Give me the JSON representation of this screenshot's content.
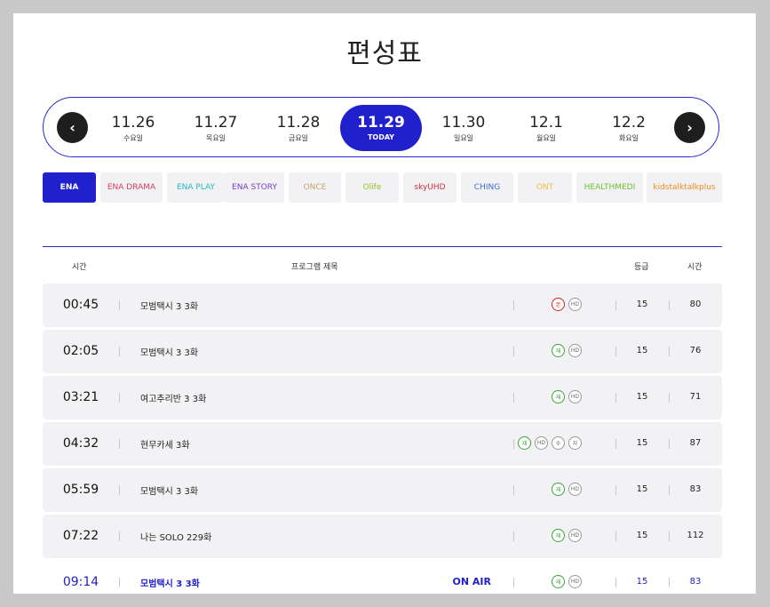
{
  "page_title": "편성표",
  "dates": [
    {
      "date": "11.26",
      "weekday": "수요일",
      "active": false
    },
    {
      "date": "11.27",
      "weekday": "목요일",
      "active": false
    },
    {
      "date": "11.28",
      "weekday": "금요일",
      "active": false
    },
    {
      "date": "11.29",
      "weekday": "TODAY",
      "active": true
    },
    {
      "date": "11.30",
      "weekday": "일요일",
      "active": false
    },
    {
      "date": "12.1",
      "weekday": "월요일",
      "active": false
    },
    {
      "date": "12.2",
      "weekday": "화요일",
      "active": false
    }
  ],
  "nav": {
    "prev": "‹",
    "next": "›"
  },
  "channels": [
    {
      "label": "ENA",
      "color": "#ffffff",
      "active": true
    },
    {
      "label": "ENA DRAMA",
      "color": "#e03a5c",
      "active": false
    },
    {
      "label": "ENA PLAY",
      "color": "#20b8c8",
      "active": false
    },
    {
      "label": "ENA STORY",
      "color": "#7a40c8",
      "active": false
    },
    {
      "label": "ONCE",
      "color": "#c8a070",
      "active": false
    },
    {
      "label": "Olife",
      "color": "#90c020",
      "active": false
    },
    {
      "label": "skyUHD",
      "color": "#d03040",
      "active": false
    },
    {
      "label": "CHING",
      "color": "#3a70d0",
      "active": false
    },
    {
      "label": "ONT",
      "color": "#f0c040",
      "active": false
    },
    {
      "label": "HEALTHMEDI",
      "color": "#70c030",
      "active": false
    },
    {
      "label": "kidstalktalkplus",
      "color": "#f08a20",
      "active": false
    }
  ],
  "table_header": {
    "time": "시간",
    "program": "프로그램 제목",
    "grade": "등급",
    "duration": "시간"
  },
  "schedule": [
    {
      "time": "00:45",
      "program": "모범택시 3 3화",
      "badges": [
        "본",
        "HD"
      ],
      "grade": "15",
      "duration": "80",
      "onair": false
    },
    {
      "time": "02:05",
      "program": "모범택시 3 3화",
      "badges": [
        "재",
        "HD"
      ],
      "grade": "15",
      "duration": "76",
      "onair": false
    },
    {
      "time": "03:21",
      "program": "여고추리반 3 3화",
      "badges": [
        "재",
        "HD"
      ],
      "grade": "15",
      "duration": "71",
      "onair": false
    },
    {
      "time": "04:32",
      "program": "현무카세 3화",
      "badges": [
        "재",
        "HD",
        "수",
        "자"
      ],
      "grade": "15",
      "duration": "87",
      "onair": false
    },
    {
      "time": "05:59",
      "program": "모범택시 3 3화",
      "badges": [
        "재",
        "HD"
      ],
      "grade": "15",
      "duration": "83",
      "onair": false
    },
    {
      "time": "07:22",
      "program": "나는 SOLO 229화",
      "badges": [
        "재",
        "HD"
      ],
      "grade": "15",
      "duration": "112",
      "onair": false
    },
    {
      "time": "09:14",
      "program": "모범택시 3 3화",
      "badges": [
        "재",
        "HD"
      ],
      "grade": "15",
      "duration": "83",
      "onair": true,
      "onair_label": "ON AIR"
    }
  ],
  "colors": {
    "accent": "#2020cc",
    "row_bg": "#f2f2f4",
    "rerun": "#3aa03a",
    "original": "#d02020"
  }
}
